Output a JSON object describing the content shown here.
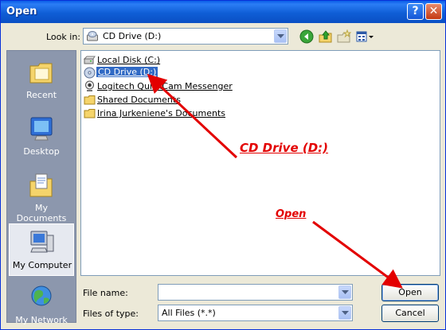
{
  "window": {
    "title": "Open"
  },
  "title_buttons": {
    "help_glyph": "?",
    "close_glyph": "✕"
  },
  "lookin": {
    "label": "Look in:",
    "value": "CD Drive (D:)",
    "icon": "cd-drive-icon"
  },
  "toolbar": {
    "icons": [
      "back-icon",
      "up-folder-icon",
      "new-folder-icon",
      "views-menu-icon"
    ]
  },
  "places": [
    {
      "label": "Recent",
      "icon": "recent-icon"
    },
    {
      "label": "Desktop",
      "icon": "desktop-icon"
    },
    {
      "label": "My Documents",
      "icon": "my-documents-icon"
    },
    {
      "label": "My Computer",
      "icon": "my-computer-icon",
      "selected": true
    },
    {
      "label": "My Network",
      "icon": "my-network-icon"
    }
  ],
  "files": [
    {
      "name": "Local Disk (C:)",
      "icon": "hard-disk-icon"
    },
    {
      "name": "CD Drive (D:)",
      "icon": "cd-drive-icon",
      "selected": true
    },
    {
      "name": "Logitech QuickCam Messenger",
      "icon": "webcam-icon"
    },
    {
      "name": "Shared Documents",
      "icon": "folder-icon"
    },
    {
      "name": "Irina Jurkeniene's Documents",
      "icon": "folder-icon"
    }
  ],
  "filename": {
    "label": "File name:",
    "value": ""
  },
  "filetype": {
    "label": "Files of type:",
    "value": "All Files (*.*)"
  },
  "buttons": {
    "open": "Open",
    "cancel": "Cancel"
  },
  "annotations": {
    "cd_drive": "CD Drive (D:)",
    "open": "Open",
    "color": "#e30000"
  }
}
